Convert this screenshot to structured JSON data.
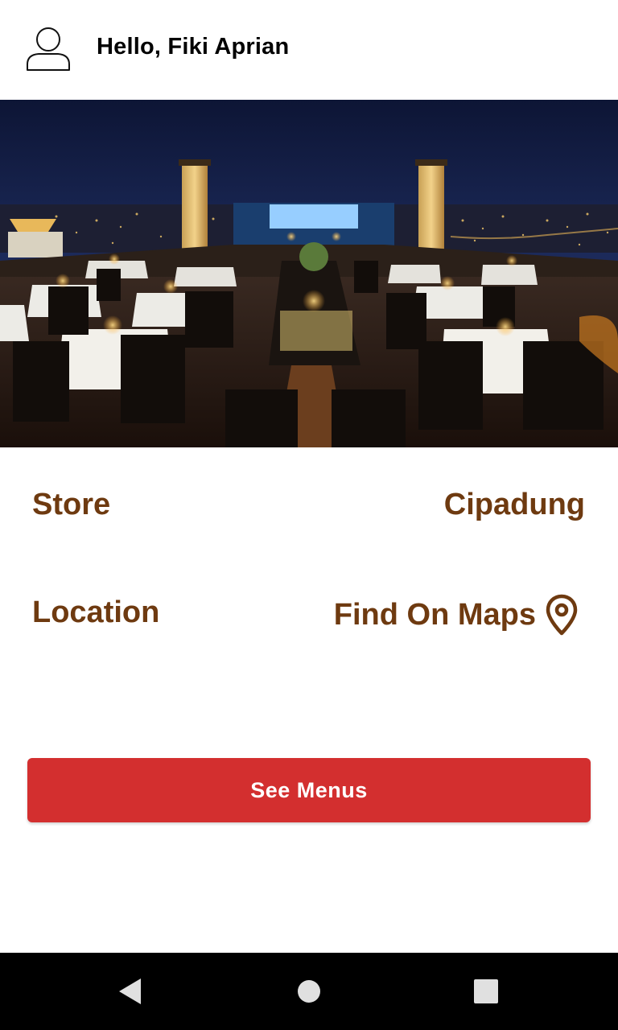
{
  "header": {
    "greeting": "Hello, Fiki Aprian",
    "avatar_icon": "user-outline-icon"
  },
  "hero": {
    "image": "rooftop-restaurant-night-photo"
  },
  "store": {
    "label": "Store",
    "value": "Cipadung"
  },
  "location": {
    "label": "Location",
    "link_label": "Find On Maps",
    "icon": "map-pin-icon"
  },
  "actions": {
    "see_menus_label": "See Menus"
  },
  "navbar": {
    "back_icon": "back-triangle-icon",
    "home_icon": "home-circle-icon",
    "recents_icon": "recents-square-icon"
  },
  "colors": {
    "label_brown": "#6e3a10",
    "button_red": "#d32f2f",
    "navbar_black": "#000000"
  }
}
